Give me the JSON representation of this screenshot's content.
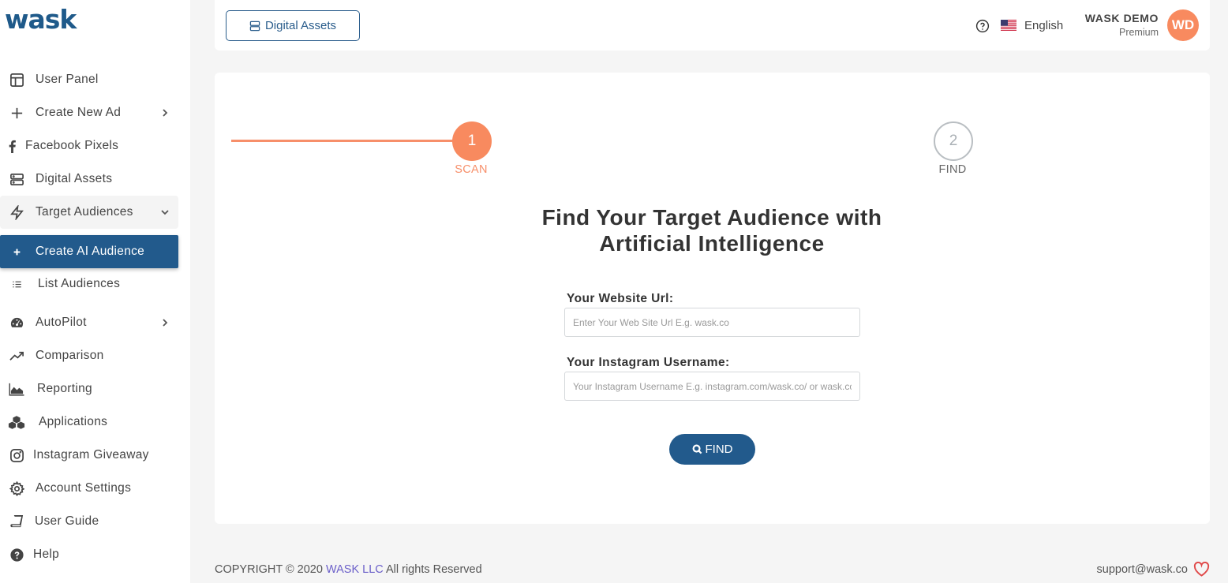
{
  "app": {
    "logo_text": "wask"
  },
  "sidebar": {
    "items": [
      {
        "label": "User Panel",
        "icon": "layout-icon"
      },
      {
        "label": "Create New Ad",
        "icon": "plus-icon"
      },
      {
        "label": "Facebook Pixels",
        "icon": "facebook-icon"
      },
      {
        "label": "Digital Assets",
        "icon": "server-icon"
      },
      {
        "label": "Target Audiences",
        "icon": "bolt-icon"
      },
      {
        "label": "Create AI Audience",
        "icon": "plus-small-icon"
      },
      {
        "label": "List Audiences",
        "icon": "list-icon"
      },
      {
        "label": "AutoPilot",
        "icon": "gauge-icon"
      },
      {
        "label": "Comparison",
        "icon": "trend-icon"
      },
      {
        "label": "Reporting",
        "icon": "area-chart-icon"
      },
      {
        "label": "Applications",
        "icon": "cubes-icon"
      },
      {
        "label": "Instagram Giveaway",
        "icon": "instagram-icon"
      },
      {
        "label": "Account Settings",
        "icon": "gear-icon"
      },
      {
        "label": "User Guide",
        "icon": "book-icon"
      },
      {
        "label": "Help",
        "icon": "question-circle-icon"
      }
    ]
  },
  "header": {
    "assets_button": "Digital Assets",
    "language": "English",
    "user_name": "WASK DEMO",
    "user_plan": "Premium",
    "avatar_initials": "WD"
  },
  "steps": [
    {
      "number": "1",
      "label": "SCAN"
    },
    {
      "number": "2",
      "label": "FIND"
    }
  ],
  "main": {
    "title_line1": "Find Your Target Audience with",
    "title_line2": "Artificial Intelligence",
    "website_label": "Your Website Url:",
    "website_placeholder": "Enter Your Web Site Url E.g. wask.co",
    "instagram_label": "Your Instagram Username:",
    "instagram_placeholder": "Your Instagram Username E.g. instagram.com/wask.co/ or wask.co",
    "find_button": "FIND"
  },
  "footer": {
    "copyright_prefix": "COPYRIGHT © 2020 ",
    "company": "WASK LLC",
    "copyright_suffix": " All rights Reserved",
    "support_email": "support@wask.co"
  },
  "colors": {
    "primary": "#225a8c",
    "accent": "#f88a5f",
    "link": "#6b5fc9"
  }
}
